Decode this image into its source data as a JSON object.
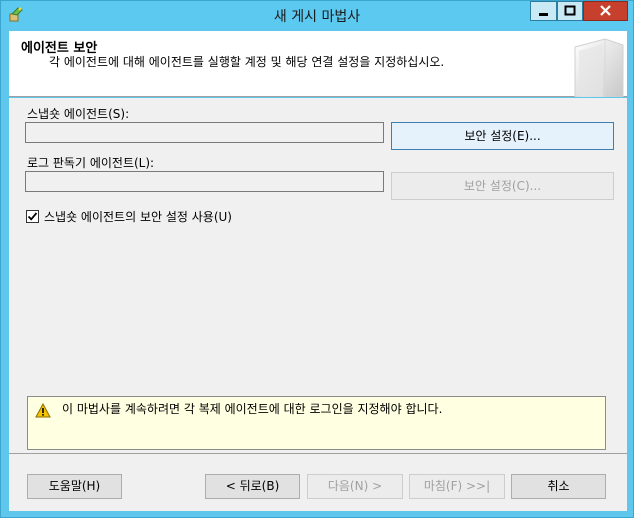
{
  "window": {
    "title": "새 게시 마법사"
  },
  "header": {
    "title": "에이전트 보안",
    "description": "각 에이전트에 대해 에이전트를 실행할 계정 및 해당 연결 설정을 지정하십시오."
  },
  "snapshot_agent": {
    "label": "스냅숏 에이전트(S):",
    "value": "",
    "button_label": "보안 설정(E)..."
  },
  "logreader_agent": {
    "label": "로그 판독기 에이전트(L):",
    "value": "",
    "button_label": "보안 설정(C)..."
  },
  "use_snapshot_security": {
    "label": "스냅숏 에이전트의 보안 설정 사용(U)",
    "checked": true
  },
  "warning": {
    "text": "이 마법사를 계속하려면 각 복제 에이전트에 대한 로그인을 지정해야 합니다."
  },
  "footer": {
    "help": "도움말(H)",
    "back": "< 뒤로(B)",
    "next": "다음(N) >",
    "finish": "마침(F) >>|",
    "cancel": "취소"
  },
  "colors": {
    "titlebar": "#5ccaf0",
    "close_button": "#c7402d",
    "warning_bg": "#ffffe1",
    "focus_border": "#3c7fb1"
  }
}
